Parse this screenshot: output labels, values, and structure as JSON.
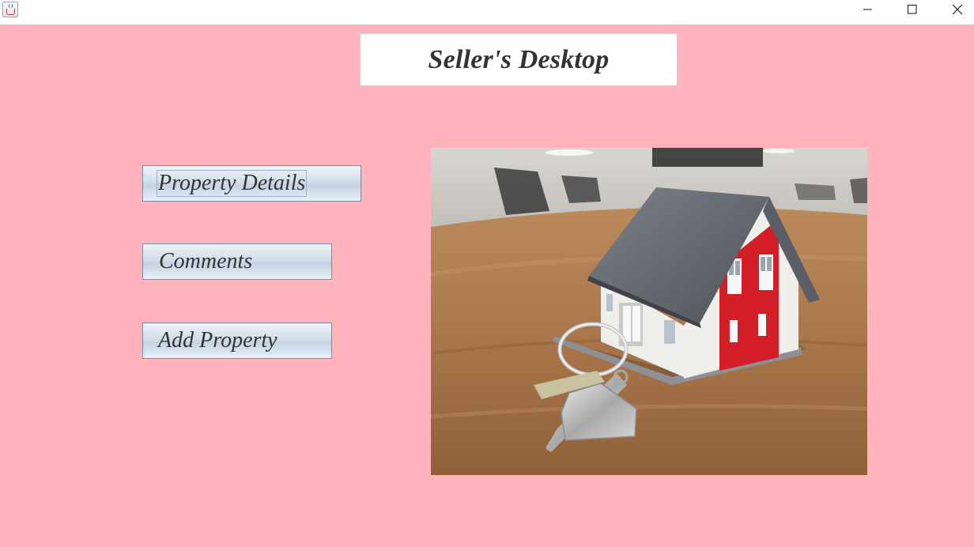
{
  "window": {
    "icon": "java-cup-icon",
    "controls": {
      "minimize": "minimize-icon",
      "maximize": "maximize-icon",
      "close": "close-icon"
    }
  },
  "header": {
    "title": "Seller's Desktop"
  },
  "menu": {
    "property_details_label": "Property Details",
    "comments_label": "Comments",
    "add_property_label": "Add Property"
  },
  "colors": {
    "background": "#ffb3bd",
    "header_bg": "#ffffff",
    "text": "#333333"
  }
}
